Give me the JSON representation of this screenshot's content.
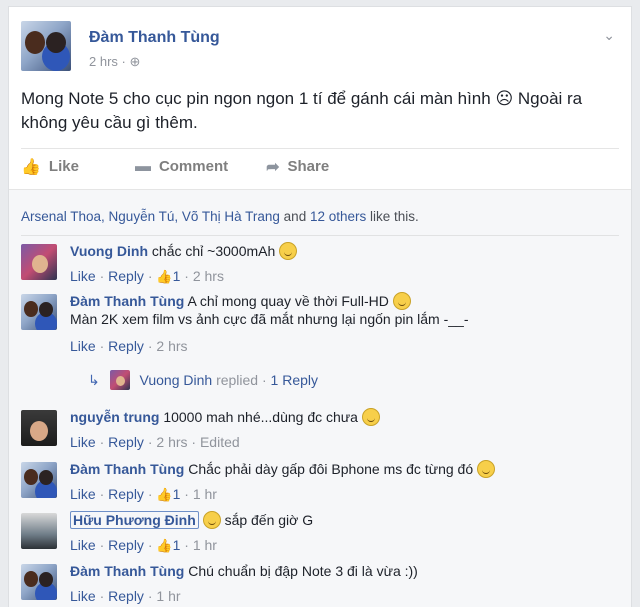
{
  "post": {
    "author": "Đàm Thanh Tùng",
    "time": "2 hrs",
    "privacy_icon": "globe-icon",
    "text": "Mong Note 5 cho cục pin ngon ngon 1 tí để gánh cái màn hình ☹ Ngoài ra không yêu cầu gì thêm.",
    "actions": {
      "like": "Like",
      "comment": "Comment",
      "share": "Share"
    }
  },
  "likes": {
    "names": "Arsenal Thoa, Nguyễn Tú, Võ Thị Hà Trang",
    "and": "and",
    "others": "12 others",
    "suffix": "like this."
  },
  "comments": [
    {
      "author": "Vuong Dinh",
      "text": "chắc chỉ ~3000mAh",
      "like": "Like",
      "reply": "Reply",
      "likes": "1",
      "time": "2 hrs"
    },
    {
      "author": "Đàm Thanh Tùng",
      "text": "A chỉ mong quay về thời Full-HD",
      "text2": "Màn 2K xem film vs ảnh cực đã mắt nhưng lại ngốn pin lắm -__-",
      "like": "Like",
      "reply": "Reply",
      "time": "2 hrs",
      "reply_summary": {
        "author": "Vuong Dinh",
        "verb": "replied",
        "count": "1 Reply"
      }
    },
    {
      "author": "nguyễn trung",
      "text": "10000 mah nhé...dùng đc chưa",
      "like": "Like",
      "reply": "Reply",
      "time": "2 hrs",
      "edited": "Edited"
    },
    {
      "author": "Đàm Thanh Tùng",
      "text": "Chắc phải dày gấp đôi Bphone ms đc từng đó",
      "like": "Like",
      "reply": "Reply",
      "likes": "1",
      "time": "1 hr"
    },
    {
      "author": "Hữu Phương Đinh",
      "text": "sắp đến giờ G",
      "like": "Like",
      "reply": "Reply",
      "likes": "1",
      "time": "1 hr"
    },
    {
      "author": "Đàm Thanh Tùng",
      "text": "Chú chuẩn bị đập Note 3 đi là vừa :))",
      "like": "Like",
      "reply": "Reply",
      "time": "1 hr"
    }
  ]
}
